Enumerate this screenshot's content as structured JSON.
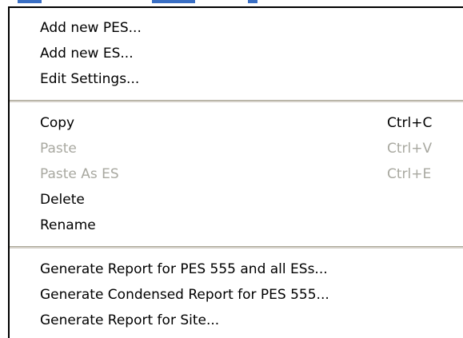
{
  "menu": {
    "groups": [
      {
        "items": [
          {
            "label": "Add new PES...",
            "shortcut": "",
            "enabled": true
          },
          {
            "label": "Add new ES...",
            "shortcut": "",
            "enabled": true
          },
          {
            "label": "Edit Settings...",
            "shortcut": "",
            "enabled": true
          }
        ]
      },
      {
        "items": [
          {
            "label": "Copy",
            "shortcut": "Ctrl+C",
            "enabled": true
          },
          {
            "label": "Paste",
            "shortcut": "Ctrl+V",
            "enabled": false
          },
          {
            "label": "Paste As ES",
            "shortcut": "Ctrl+E",
            "enabled": false
          },
          {
            "label": "Delete",
            "shortcut": "",
            "enabled": true
          },
          {
            "label": "Rename",
            "shortcut": "",
            "enabled": true
          }
        ]
      },
      {
        "items": [
          {
            "label": "Generate Report for PES 555 and all ESs...",
            "shortcut": "",
            "enabled": true
          },
          {
            "label": "Generate Condensed Report for PES 555...",
            "shortcut": "",
            "enabled": true
          },
          {
            "label": "Generate Report for Site...",
            "shortcut": "",
            "enabled": true
          }
        ]
      }
    ]
  },
  "colors": {
    "text": "#000000",
    "disabled_text": "#a8a8a0",
    "border": "#000000",
    "separator": "#aca899"
  }
}
